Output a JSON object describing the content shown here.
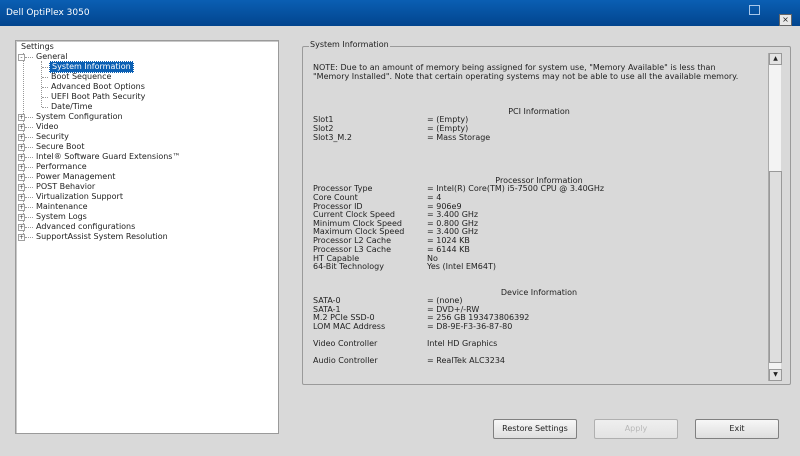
{
  "window": {
    "title": "Dell OptiPlex 3050",
    "close_glyph": "×"
  },
  "tree": {
    "root": "Settings",
    "general": {
      "label": "General",
      "toggle": "-",
      "children": [
        "System Information",
        "Boot Sequence",
        "Advanced Boot Options",
        "UEFI Boot Path Security",
        "Date/Time"
      ]
    },
    "items": [
      "System Configuration",
      "Video",
      "Security",
      "Secure Boot",
      "Intel® Software Guard Extensions™",
      "Performance",
      "Power Management",
      "POST Behavior",
      "Virtualization Support",
      "Maintenance",
      "System Logs",
      "Advanced configurations",
      "SupportAssist System Resolution"
    ],
    "expand_glyph": "+"
  },
  "panel": {
    "title": "System Information",
    "note": "NOTE: Due to an amount of memory being assigned for system use, \"Memory Available\" is less than \"Memory Installed\". Note that certain operating systems may not be able to use all the available memory.",
    "pci": {
      "title": "PCI Information",
      "rows": [
        {
          "label": "Slot1",
          "value": "= (Empty)"
        },
        {
          "label": "Slot2",
          "value": "= (Empty)"
        },
        {
          "label": "Slot3_M.2",
          "value": "= Mass Storage"
        }
      ]
    },
    "processor": {
      "title": "Processor Information",
      "rows": [
        {
          "label": "Processor Type",
          "value": "= Intel(R) Core(TM) i5-7500 CPU @ 3.40GHz"
        },
        {
          "label": "Core Count",
          "value": "= 4"
        },
        {
          "label": "Processor ID",
          "value": "= 906e9"
        },
        {
          "label": "Current Clock Speed",
          "value": "= 3.400 GHz"
        },
        {
          "label": "Minimum Clock Speed",
          "value": "= 0.800 GHz"
        },
        {
          "label": "Maximum Clock Speed",
          "value": "= 3.400 GHz"
        },
        {
          "label": "Processor L2 Cache",
          "value": "= 1024 KB"
        },
        {
          "label": "Processor L3 Cache",
          "value": "= 6144 KB"
        },
        {
          "label": "HT Capable",
          "value": "No"
        },
        {
          "label": "64-Bit Technology",
          "value": "Yes (Intel EM64T)"
        }
      ]
    },
    "device": {
      "title": "Device Information",
      "rows": [
        {
          "label": "SATA-0",
          "value": "= (none)"
        },
        {
          "label": "SATA-1",
          "value": "= DVD+/-RW"
        },
        {
          "label": "M.2 PCIe SSD-0",
          "value": "= 256 GB 193473806392"
        },
        {
          "label": "LOM MAC Address",
          "value": "= D8-9E-F3-36-87-80"
        },
        {
          "label": "Video Controller",
          "value": "Intel HD Graphics"
        },
        {
          "label": "Audio Controller",
          "value": "= RealTek ALC3234"
        }
      ]
    }
  },
  "scroll": {
    "up": "▲",
    "down": "▼"
  },
  "buttons": {
    "restore": "Restore Settings",
    "apply": "Apply",
    "exit": "Exit"
  }
}
